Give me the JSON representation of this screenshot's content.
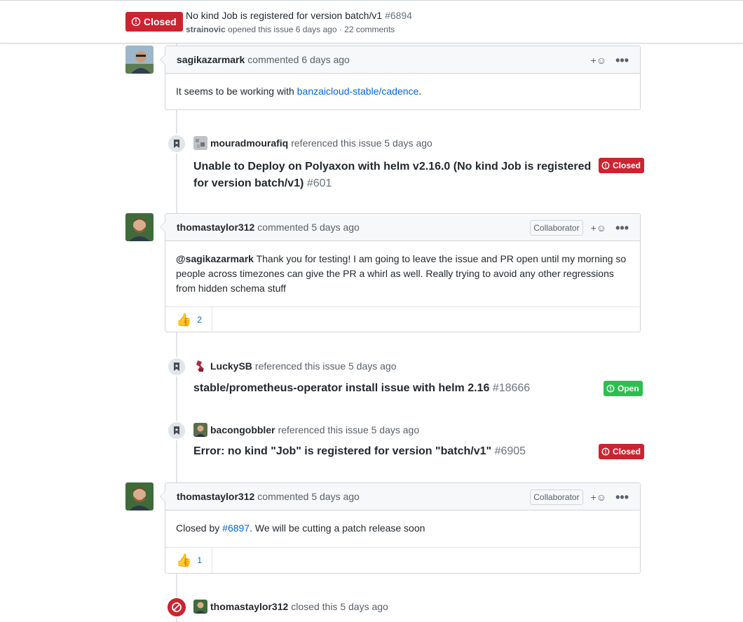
{
  "header": {
    "state_label": "Closed",
    "title": "No kind Job is registered for version batch/v1",
    "number": "#6894",
    "author": "strainovic",
    "meta": "opened this issue 6 days ago · 22 comments"
  },
  "comments": [
    {
      "author": "sagikazarmark",
      "action": "commented 6 days ago",
      "body_prefix": "It seems to be working with ",
      "body_link": "banzaicloud-stable/cadence",
      "body_suffix": "."
    },
    {
      "author": "thomastaylor312",
      "action": "commented 5 days ago",
      "role": "Collaborator",
      "body_mention": "@sagikazarmark",
      "body_text": " Thank you for testing! I am going to leave the issue and PR open until my morning so people across timezones can give the PR a whirl as well. Really trying to avoid any other regressions from hidden schema stuff",
      "reaction_emoji": "👍",
      "reaction_count": "2"
    },
    {
      "author": "thomastaylor312",
      "action": "commented 5 days ago",
      "role": "Collaborator",
      "body_prefix": "Closed by ",
      "body_link": "#6897",
      "body_suffix": ". We will be cutting a patch release soon",
      "reaction_emoji": "👍",
      "reaction_count": "1"
    }
  ],
  "references": [
    {
      "author": "mouradmourafiq",
      "action": "referenced this issue 5 days ago",
      "title_line1": "Unable to Deploy on Polyaxon with helm v2.16.0 (No kind Job is registered",
      "title_line2": "for version batch/v1)",
      "number": "#601",
      "state": "Closed"
    },
    {
      "author": "LuckySB",
      "action": "referenced this issue 5 days ago",
      "title": "stable/prometheus-operator install issue with helm 2.16",
      "number": "#18666",
      "state": "Open"
    },
    {
      "author": "bacongobbler",
      "action": "referenced this issue 5 days ago",
      "title": "Error: no kind \"Job\" is registered for version \"batch/v1\"",
      "number": "#6905",
      "state": "Closed"
    }
  ],
  "close_event": {
    "author": "thomastaylor312",
    "action": "closed this 5 days ago"
  },
  "icons": {
    "add_reaction": "+☺",
    "more": "•••"
  },
  "colors": {
    "closed_red": "#cb2431",
    "open_green": "#2cbe4e",
    "link_blue": "#0366d6"
  }
}
